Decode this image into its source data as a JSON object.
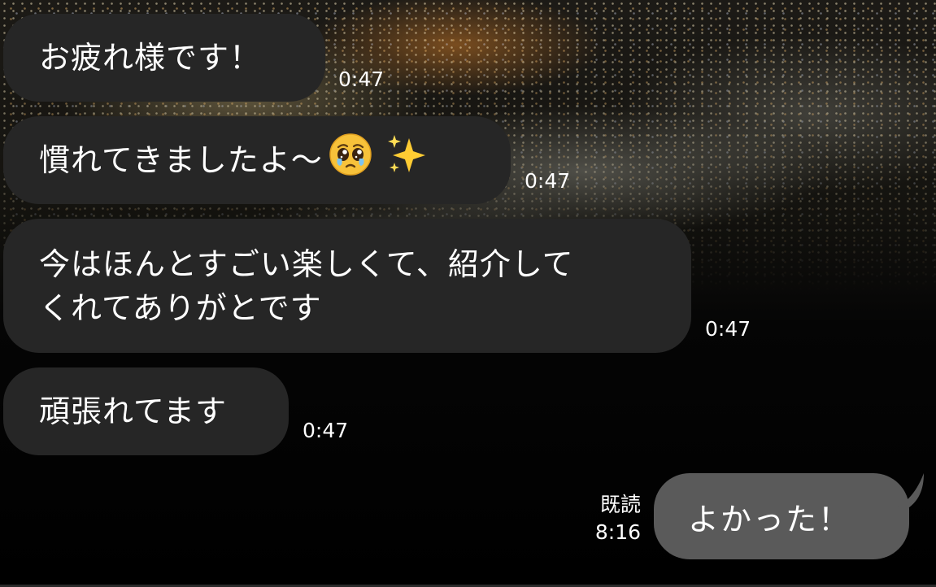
{
  "messages_received": [
    {
      "text": "お疲れ様です！",
      "time": "0:47"
    },
    {
      "text": "慣れてきましたよ〜",
      "emoji": [
        "pleading-face-emoji",
        "sparkles-emoji"
      ],
      "time": "0:47"
    },
    {
      "lines": [
        "今はほんとすごい楽しくて、紹介して",
        "くれてありがとです"
      ],
      "time": "0:47"
    },
    {
      "text": "頑張れてます",
      "time": "0:47"
    }
  ],
  "message_sent": {
    "text": "よかった！",
    "read_status": "既読",
    "time": "8:16"
  },
  "colors": {
    "received_bubble": "#262626",
    "sent_bubble": "#5a5a5a",
    "text": "#ffffff",
    "background": "#000000"
  },
  "background": {
    "type": "night-city-lights-photo"
  }
}
